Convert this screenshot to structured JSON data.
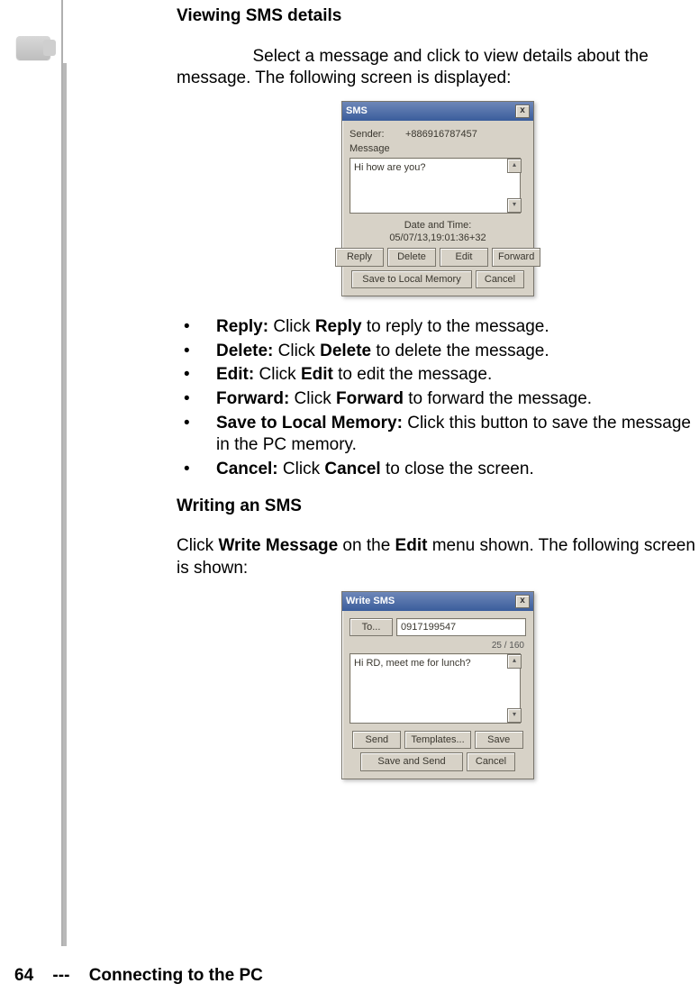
{
  "headings": {
    "viewing": "Viewing SMS details",
    "writing": "Writing an SMS"
  },
  "paragraphs": {
    "view_lead_indent": "                Select a message and click to view details about the message. The following screen is displayed:",
    "writing_para": "Click ",
    "writing_b1": "Write Message",
    "writing_mid": " on the ",
    "writing_b2": "Edit",
    "writing_end": " menu shown. The following screen is shown:"
  },
  "bullets": [
    {
      "label": "Reply:",
      "textA": " Click ",
      "bold": "Reply",
      "textB": " to reply to the message."
    },
    {
      "label": "Delete:",
      "textA": " Click ",
      "bold": "Delete",
      "textB": " to delete the message."
    },
    {
      "label": "Edit:",
      "textA": " Click ",
      "bold": "Edit",
      "textB": " to edit the message."
    },
    {
      "label": "Forward:",
      "textA": " Click ",
      "bold": "Forward",
      "textB": " to forward the message."
    },
    {
      "label": "Save to Local Memory:",
      "textA": " Click this button to save the message in the PC memory.",
      "bold": "",
      "textB": ""
    },
    {
      "label": "Cancel:",
      "textA": " Click ",
      "bold": "Cancel",
      "textB": " to close the screen."
    }
  ],
  "dialog1": {
    "title": "SMS",
    "sender_lbl": "Sender:",
    "sender_val": "+886916787457",
    "message_lbl": "Message",
    "message_text": "Hi how are you?",
    "datetime_lbl": "Date and Time:",
    "datetime_val": "05/07/13,19:01:36+32",
    "buttons": {
      "reply": "Reply",
      "delete": "Delete",
      "edit": "Edit",
      "forward": "Forward",
      "save": "Save to Local Memory",
      "cancel": "Cancel"
    }
  },
  "dialog2": {
    "title": "Write SMS",
    "to_btn": "To...",
    "to_val": "0917199547",
    "counter": "25 / 160",
    "body": "Hi RD, meet me for lunch?",
    "buttons": {
      "send": "Send",
      "templates": "Templates...",
      "save": "Save",
      "savesend": "Save and Send",
      "cancel": "Cancel"
    }
  },
  "footer": {
    "page": "64",
    "sep": "---",
    "chapter": "Connecting to the PC"
  }
}
